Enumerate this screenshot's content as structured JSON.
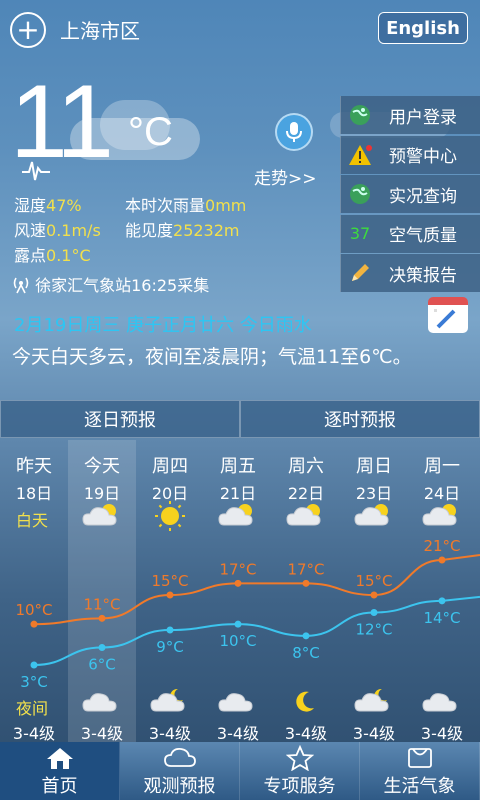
{
  "header": {
    "add_icon": "plus-circle-icon",
    "city": "上海市区",
    "language_button": "English"
  },
  "current": {
    "temperature": "11",
    "unit": "°C",
    "trend_label": "走势>>",
    "humidity_label": "湿度",
    "humidity_value": "47%",
    "rain_label": "本时次雨量",
    "rain_value": "0mm",
    "wind_label": "风速",
    "wind_value": "0.1m/s",
    "visibility_label": "能见度",
    "visibility_value": "25232m",
    "dew_label": "露点",
    "dew_value": "0.1°C",
    "station": "徐家汇气象站16:25采集"
  },
  "side_menu": [
    {
      "icon": "globe-icon",
      "label": "用户登录"
    },
    {
      "icon": "warning-icon",
      "label": "预警中心"
    },
    {
      "icon": "globe-icon",
      "label": "实况查询"
    },
    {
      "icon": "aqi-badge",
      "badge": "37",
      "label": "空气质量"
    },
    {
      "icon": "pencil-icon",
      "label": "决策报告"
    }
  ],
  "date_line": "2月19日周三  庚子正月廿六  今日雨水",
  "description": "今天白天多云，夜间至凌晨阴；气温11至6℃。",
  "tabs": [
    "逐日预报",
    "逐时预报"
  ],
  "forecast": {
    "day_label": "白天",
    "night_label": "夜间",
    "days": [
      {
        "name": "昨天",
        "date": "18日",
        "day_icon": "",
        "high": "10°C",
        "low": "3°C",
        "night_icon": "",
        "wind": "3-4级"
      },
      {
        "name": "今天",
        "date": "19日",
        "day_icon": "partly-cloudy-icon",
        "high": "11°C",
        "low": "6°C",
        "night_icon": "cloudy-icon",
        "wind": "3-4级"
      },
      {
        "name": "周四",
        "date": "20日",
        "day_icon": "sunny-icon",
        "high": "15°C",
        "low": "9°C",
        "night_icon": "cloudy-moon-icon",
        "wind": "3-4级"
      },
      {
        "name": "周五",
        "date": "21日",
        "day_icon": "partly-cloudy-icon",
        "high": "17°C",
        "low": "10°C",
        "night_icon": "cloudy-icon",
        "wind": "3-4级"
      },
      {
        "name": "周六",
        "date": "22日",
        "day_icon": "partly-cloudy-icon",
        "high": "17°C",
        "low": "8°C",
        "night_icon": "moon-icon",
        "wind": "3-4级"
      },
      {
        "name": "周日",
        "date": "23日",
        "day_icon": "partly-cloudy-icon",
        "high": "15°C",
        "low": "12°C",
        "night_icon": "cloudy-moon-icon",
        "wind": "3-4级"
      },
      {
        "name": "周一",
        "date": "24日",
        "day_icon": "partly-cloudy-icon",
        "high": "21°C",
        "low": "14°C",
        "night_icon": "cloudy-icon",
        "wind": "3-4级"
      }
    ],
    "highs": [
      10,
      11,
      15,
      17,
      17,
      15,
      21
    ],
    "lows": [
      3,
      6,
      9,
      10,
      8,
      12,
      14
    ],
    "high_color": "#f07a2a",
    "low_color": "#3cc4ee"
  },
  "bottom_nav": [
    {
      "icon": "home-icon",
      "label": "首页",
      "active": true
    },
    {
      "icon": "cloud-icon",
      "label": "观测预报"
    },
    {
      "icon": "star-icon",
      "label": "专项服务"
    },
    {
      "icon": "basket-icon",
      "label": "生活气象"
    }
  ]
}
